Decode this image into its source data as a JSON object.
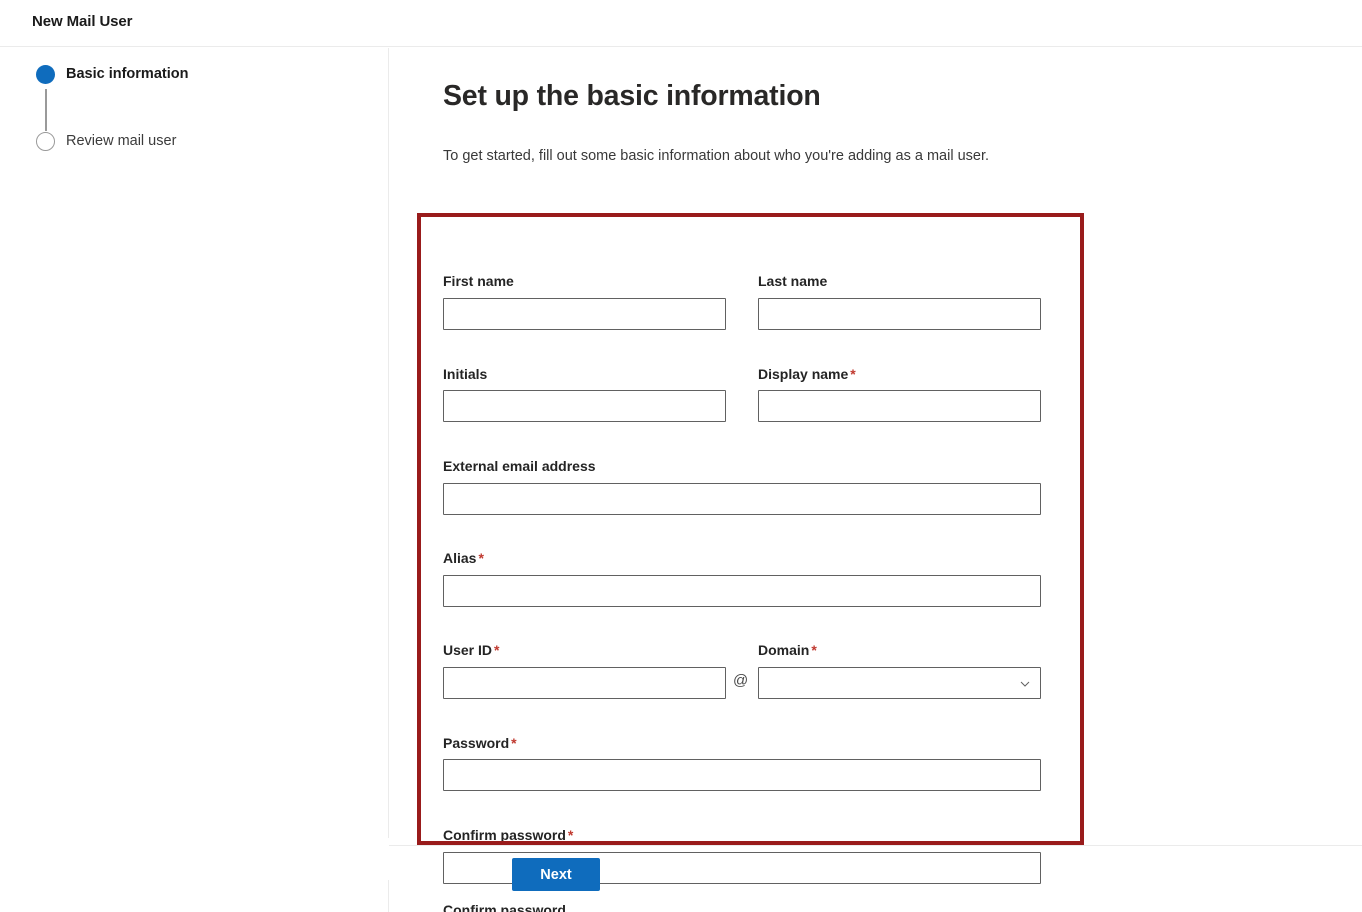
{
  "header": {
    "title": "New Mail User"
  },
  "wizard": {
    "steps": [
      {
        "label": "Basic information",
        "state": "active",
        "marker": "filled-circle-icon"
      },
      {
        "label": "Review mail user",
        "state": "inactive",
        "marker": "empty-circle-icon"
      }
    ]
  },
  "main": {
    "title": "Set up the basic information",
    "subtitle": "To get started, fill out some basic information about who you're adding as a mail user."
  },
  "form": {
    "fields": [
      {
        "label": "First name",
        "required": false,
        "value": "",
        "placeholder": "",
        "type": "text"
      },
      {
        "label": "Last name",
        "required": false,
        "value": "",
        "placeholder": "",
        "type": "text"
      },
      {
        "label": "Initials",
        "required": false,
        "value": "",
        "placeholder": "",
        "type": "text"
      },
      {
        "label": "Display name",
        "required": true,
        "value": "",
        "placeholder": "",
        "type": "text"
      },
      {
        "label": "External email address",
        "required": false,
        "value": "",
        "placeholder": "",
        "type": "text"
      },
      {
        "label": "Alias",
        "required": true,
        "value": "",
        "placeholder": "",
        "type": "text"
      },
      {
        "label": "User ID",
        "required": true,
        "value": "",
        "placeholder": "",
        "type": "text"
      },
      {
        "label": "Domain",
        "required": true,
        "value": "",
        "placeholder": "",
        "type": "select"
      },
      {
        "label": "Password",
        "required": true,
        "value": "",
        "placeholder": "",
        "type": "password"
      },
      {
        "label": "Confirm password",
        "required": true,
        "value": "",
        "placeholder": "",
        "type": "password"
      }
    ],
    "required_marker": "*",
    "at_separator": "@",
    "domain_options": []
  },
  "footer": {
    "next_label": "Next"
  },
  "clipped": {
    "label": "Confirm password"
  },
  "colors": {
    "accent_blue": "#0f6cbd",
    "highlight_red": "#991b1b",
    "required_red": "#c0392f",
    "input_border": "#616161",
    "divider": "#ebebeb"
  }
}
